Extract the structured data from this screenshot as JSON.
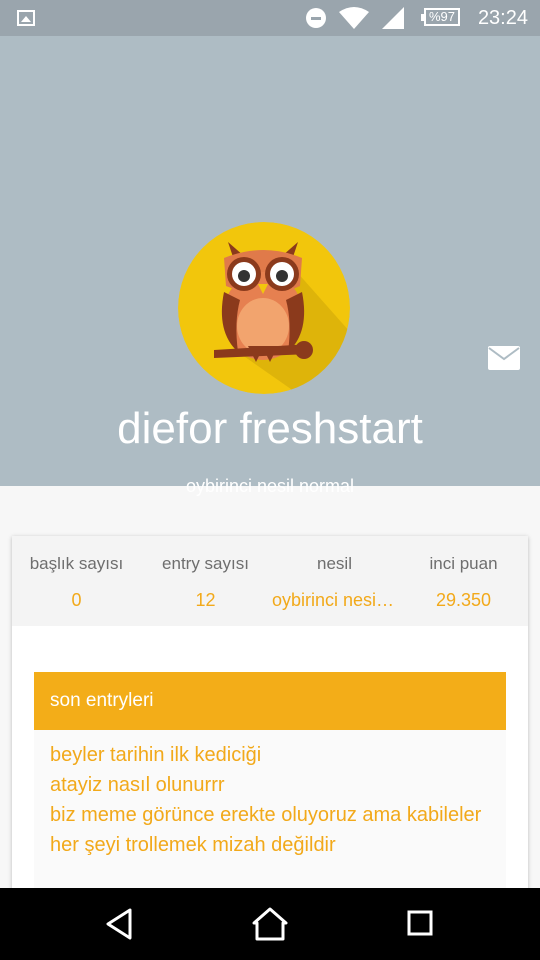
{
  "status_bar": {
    "time": "23:24",
    "battery": "%97",
    "icons": [
      "image-icon",
      "do-not-disturb-icon",
      "wifi-icon",
      "signal-icon",
      "battery-icon"
    ]
  },
  "profile": {
    "username": "diefor freshstart",
    "subtitle": "oybirinci nesil normal",
    "avatar": "owl-avatar",
    "colors": {
      "header_bg": "#aebcc4",
      "avatar_bg": "#f2c60c",
      "accent": "#f3ad18"
    }
  },
  "stats": [
    {
      "label": "başlık sayısı",
      "value": "0"
    },
    {
      "label": "entry sayısı",
      "value": "12"
    },
    {
      "label": "nesil",
      "value": "oybirinci nesil normal"
    },
    {
      "label": "inci puan",
      "value": "29.350"
    }
  ],
  "recent_entries": {
    "title": "son entryleri",
    "items": [
      "beyler tarihin ilk kediciği",
      "atayiz nasıl olunurrr",
      "biz meme görünce erekte oluyoruz ama kabileler",
      "her şeyi trollemek mizah değildir"
    ]
  },
  "nav_bar": {
    "buttons": [
      "back-icon",
      "home-icon",
      "recents-icon"
    ]
  }
}
